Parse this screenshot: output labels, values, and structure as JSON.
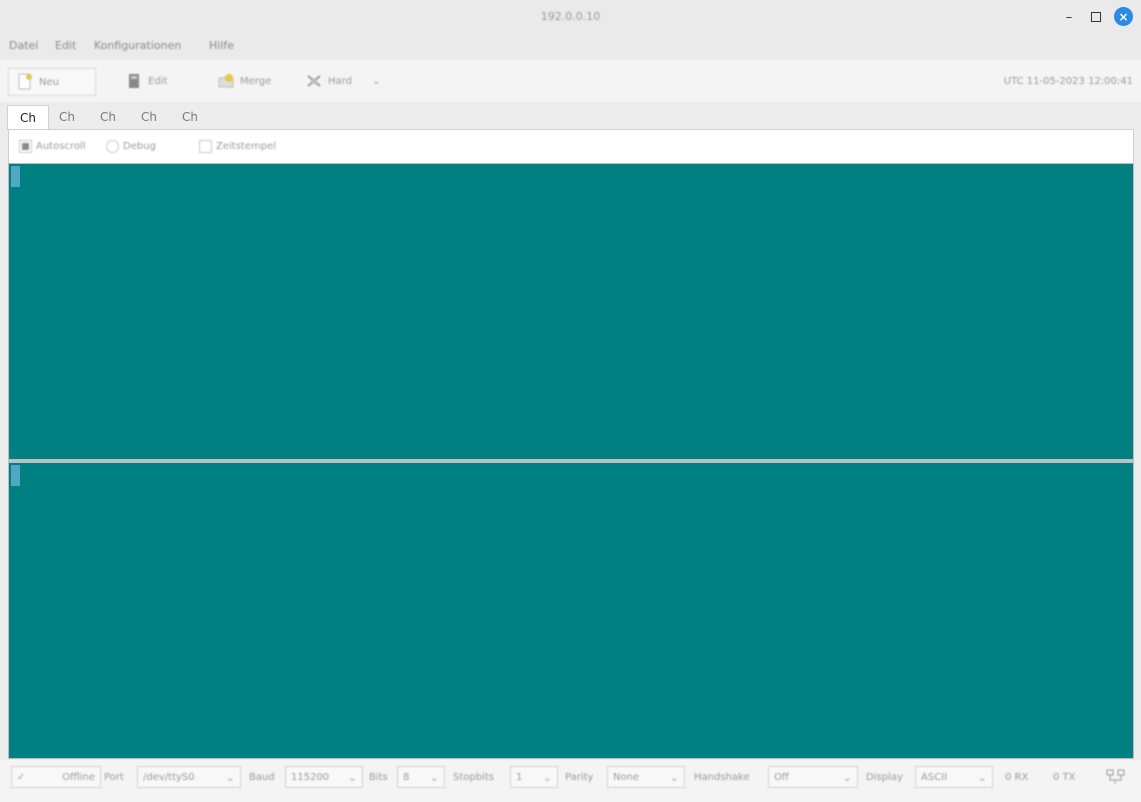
{
  "window": {
    "title": "192.0.0.10",
    "min_symbol": "–",
    "close_symbol": "×"
  },
  "menu": [
    "Datei",
    "Edit",
    "Konfigurationen",
    "Hilfe"
  ],
  "toolbar": {
    "new_label": "Neu",
    "new_icon": "new-file-icon",
    "edit_label": "Edit",
    "edit_icon": "edit-icon",
    "merge_label": "Merge",
    "merge_icon": "merge-icon",
    "hard_label": "Hard",
    "hard_icon": "connect-icon",
    "more_symbol": "⌄",
    "timestamp": "UTC 11-05-2023 12:00:41"
  },
  "tabs": [
    "Ch",
    "Ch",
    "Ch",
    "Ch",
    "Ch"
  ],
  "options": {
    "autoscroll_label": "Autoscroll",
    "debug_label": "Debug",
    "timestamp_label": "Zeitstempel"
  },
  "terminal": {
    "background": "#008080",
    "cursor_color": "#4fa8c4"
  },
  "statusbar": {
    "status_label": "Offline",
    "port_label": "Port",
    "port_value": "/dev/ttyS0",
    "baud_label": "Baud",
    "baud_value": "115200",
    "bits_label": "Bits",
    "bits_value": "8",
    "stopbits_label": "Stopbits",
    "stopbits_value": "1",
    "parity_label": "Parity",
    "parity_value": "None",
    "handshake_label": "Handshake",
    "handshake_value": "Off",
    "display_label": "Display",
    "display_value": "ASCII",
    "rx_text": "0 RX",
    "tx_text": "0 TX"
  }
}
